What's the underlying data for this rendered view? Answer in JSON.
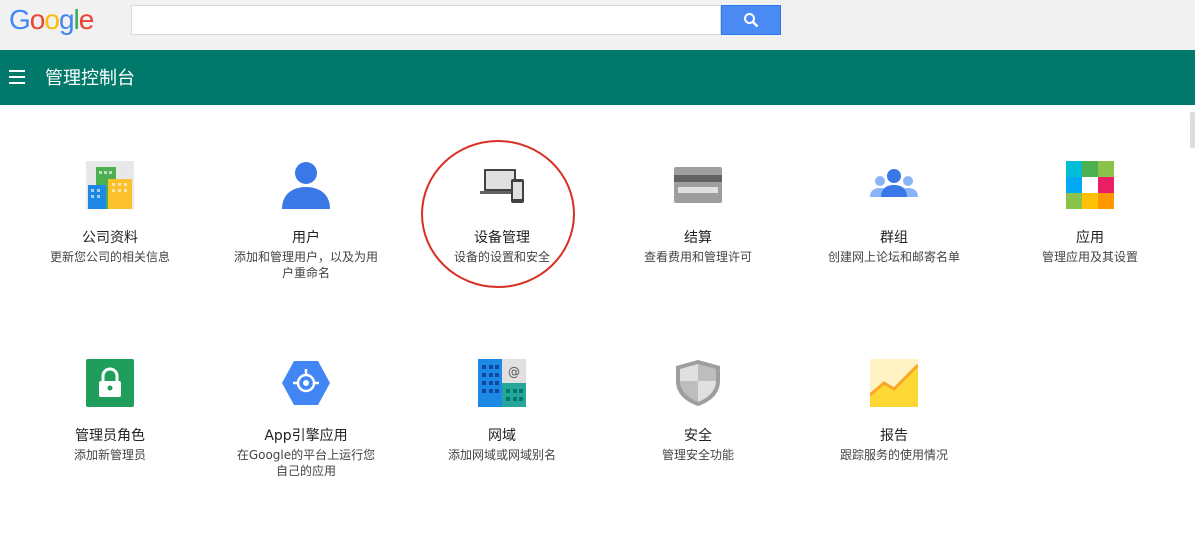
{
  "google": {
    "logo_letters": [
      {
        "ch": "G",
        "color": "#4285f4"
      },
      {
        "ch": "o",
        "color": "#ea4335"
      },
      {
        "ch": "o",
        "color": "#fbbc05"
      },
      {
        "ch": "g",
        "color": "#4285f4"
      },
      {
        "ch": "l",
        "color": "#34a853"
      },
      {
        "ch": "e",
        "color": "#ea4335"
      }
    ],
    "search_value": "",
    "search_icon": "search-icon"
  },
  "header": {
    "title": "管理控制台",
    "menu_icon": "hamburger-menu-icon",
    "bg_color": "#00796b"
  },
  "tiles": [
    {
      "title": "公司资料",
      "desc": "更新您公司的相关信息",
      "icon": "company-profile-icon"
    },
    {
      "title": "用户",
      "desc": "添加和管理用户，以及为用户重命名",
      "icon": "user-icon"
    },
    {
      "title": "设备管理",
      "desc": "设备的设置和安全",
      "icon": "devices-icon"
    },
    {
      "title": "结算",
      "desc": "查看费用和管理许可",
      "icon": "billing-card-icon"
    },
    {
      "title": "群组",
      "desc": "创建网上论坛和邮寄名单",
      "icon": "groups-icon"
    },
    {
      "title": "应用",
      "desc": "管理应用及其设置",
      "icon": "apps-grid-icon"
    },
    {
      "title": "管理员角色",
      "desc": "添加新管理员",
      "icon": "admin-lock-icon"
    },
    {
      "title": "App引擎应用",
      "desc": "在Google的平台上运行您自己的应用",
      "icon": "app-engine-icon"
    },
    {
      "title": "网域",
      "desc": "添加网域或网域别名",
      "icon": "domains-icon"
    },
    {
      "title": "安全",
      "desc": "管理安全功能",
      "icon": "security-shield-icon"
    },
    {
      "title": "报告",
      "desc": "跟踪服务的使用情况",
      "icon": "reports-chart-icon"
    }
  ]
}
